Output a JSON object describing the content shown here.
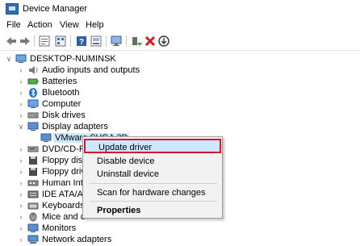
{
  "window": {
    "title": "Device Manager"
  },
  "menu": [
    "File",
    "Action",
    "View",
    "Help"
  ],
  "toolbar": {
    "buttons": [
      "back-icon",
      "forward-icon",
      "properties-icon",
      "view-icon",
      "help-icon",
      "show-hidden-icon",
      "scan-monitor-icon",
      "update-driver-icon",
      "uninstall-icon",
      "download-icon"
    ]
  },
  "tree": {
    "root": "DESKTOP-NUMINSK",
    "items": [
      {
        "label": "Audio inputs and outputs",
        "icon": "speaker-icon",
        "expanded": false
      },
      {
        "label": "Batteries",
        "icon": "battery-icon",
        "expanded": false
      },
      {
        "label": "Bluetooth",
        "icon": "bluetooth-icon",
        "expanded": false
      },
      {
        "label": "Computer",
        "icon": "computer-icon",
        "expanded": false
      },
      {
        "label": "Disk drives",
        "icon": "disk-icon",
        "expanded": false
      },
      {
        "label": "Display adapters",
        "icon": "display-icon",
        "expanded": true
      },
      {
        "label": "VMware SVGA 3D",
        "icon": "display-icon",
        "child": true,
        "selected": true
      },
      {
        "label": "DVD/CD-R",
        "icon": "dvd-icon",
        "expanded": false
      },
      {
        "label": "Floppy dis",
        "icon": "floppy-icon",
        "expanded": false
      },
      {
        "label": "Floppy driv",
        "icon": "floppy-icon",
        "expanded": false
      },
      {
        "label": "Human Int",
        "icon": "hid-icon",
        "expanded": false
      },
      {
        "label": "IDE ATA/A",
        "icon": "ide-icon",
        "expanded": false
      },
      {
        "label": "Keyboards",
        "icon": "keyboard-icon",
        "expanded": false
      },
      {
        "label": "Mice and o",
        "icon": "mouse-icon",
        "expanded": false
      },
      {
        "label": "Monitors",
        "icon": "monitor-icon",
        "expanded": false
      },
      {
        "label": "Network adapters",
        "icon": "network-icon",
        "expanded": false
      }
    ]
  },
  "context_menu": {
    "items": [
      {
        "label": "Update driver",
        "highlighted": true,
        "bold": false
      },
      {
        "label": "Disable device",
        "highlighted": false,
        "bold": false
      },
      {
        "label": "Uninstall device",
        "highlighted": false,
        "bold": false
      },
      {
        "label": "Scan for hardware changes",
        "highlighted": false,
        "bold": false
      },
      {
        "label": "Properties",
        "highlighted": false,
        "bold": true
      }
    ]
  },
  "colors": {
    "highlight": "#cce8ff",
    "highlight_border": "#d7182a",
    "menu_bg": "#f2f2f2"
  }
}
